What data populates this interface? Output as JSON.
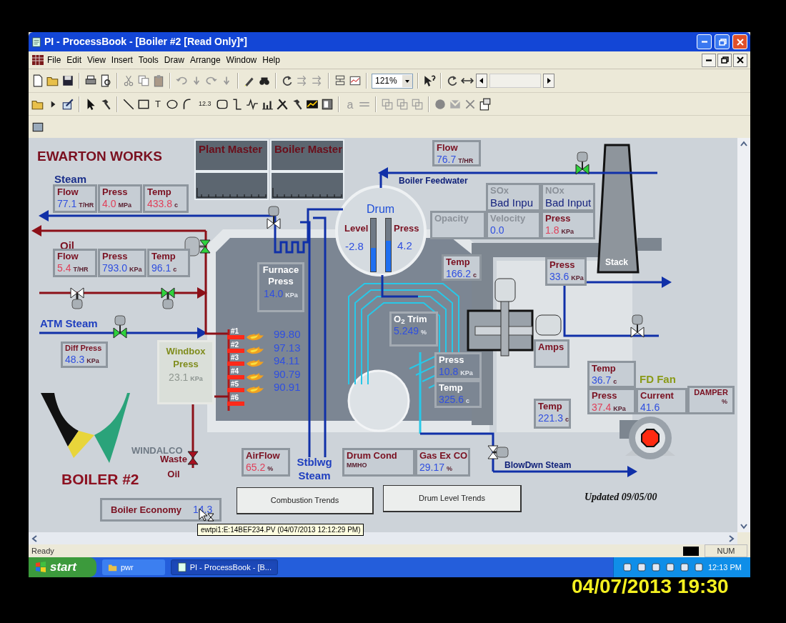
{
  "window": {
    "title": "PI - ProcessBook - [Boiler #2 [Read Only]*]"
  },
  "menu": [
    "File",
    "Edit",
    "View",
    "Insert",
    "Tools",
    "Draw",
    "Arrange",
    "Window",
    "Help"
  ],
  "toolbar": {
    "zoom": "121%",
    "text_tool": "T",
    "value_tool": "12.3",
    "font_tool": "a"
  },
  "display": {
    "labels": [
      {
        "text": "EWARTON WORKS"
      },
      {
        "text": "Steam"
      },
      {
        "text": "Oil"
      },
      {
        "text": "ATM Steam"
      },
      {
        "text": "Boiler Feedwater"
      },
      {
        "text": "Waste Oil"
      },
      {
        "text": "Stblwg Steam"
      },
      {
        "text": "BlowDwn Steam"
      },
      {
        "text": "FD Fan"
      },
      {
        "text": "Stack"
      },
      {
        "text": "WINDALCO"
      },
      {
        "text": "BOILER #2"
      },
      {
        "text": "Updated 09/05/00"
      }
    ],
    "masters": [
      "Plant Master",
      "Boiler Master"
    ],
    "readouts": [
      {
        "label": "Flow",
        "value": "77.1",
        "unit": "T/HR",
        "alarm": false,
        "kind": "light"
      },
      {
        "label": "Press",
        "value": "4.0",
        "unit": "MPa",
        "alarm": true,
        "kind": "light"
      },
      {
        "label": "Temp",
        "value": "433.8",
        "unit": "c",
        "alarm": true,
        "kind": "light"
      },
      {
        "label": "Flow",
        "value": "5.4",
        "unit": "T/HR",
        "alarm": true,
        "kind": "light"
      },
      {
        "label": "Press",
        "value": "793.0",
        "unit": "KPa",
        "alarm": false,
        "kind": "light"
      },
      {
        "label": "Temp",
        "value": "96.1",
        "unit": "c",
        "alarm": false,
        "kind": "light"
      },
      {
        "label": "Diff Press",
        "value": "48.3",
        "unit": "KPa",
        "alarm": false,
        "kind": "light"
      },
      {
        "label": "Windbox Press",
        "value": "23.1",
        "unit": "KPa",
        "kind": "olive"
      },
      {
        "label": "Furnace Press",
        "value": "14.0",
        "unit": "KPa",
        "alarm": false,
        "kind": "dark"
      },
      {
        "label": "Flow",
        "value": "76.7",
        "unit": "T/HR",
        "alarm": false,
        "kind": "light"
      },
      {
        "label": "SOx",
        "value": "Bad Inpu",
        "kind": "bad"
      },
      {
        "label": "NOx",
        "value": "Bad Input",
        "kind": "bad"
      },
      {
        "label": "Opacity",
        "kind": "dim"
      },
      {
        "label": "Velocity",
        "value": "0.0",
        "alarm": false,
        "kind": "dim"
      },
      {
        "label": "Press",
        "value": "1.8",
        "unit": "KPa",
        "alarm": true,
        "kind": "light"
      },
      {
        "label": "Temp",
        "value": "166.2",
        "unit": "c",
        "alarm": false,
        "kind": "light"
      },
      {
        "label": "Press",
        "value": "33.6",
        "unit": "KPa",
        "alarm": false,
        "kind": "light"
      },
      {
        "label": "O$_{2}$ Trim",
        "value": "5.249",
        "unit": "%",
        "alarm": false,
        "kind": "dark"
      },
      {
        "label": "Press",
        "value": "10.8",
        "unit": "KPa",
        "alarm": false,
        "kind": "dark"
      },
      {
        "label": "Temp",
        "value": "325.6",
        "unit": "c",
        "alarm": false,
        "kind": "dark"
      },
      {
        "label": "Amps",
        "kind": "light"
      },
      {
        "label": "Temp",
        "value": "221.3",
        "unit": "c",
        "alarm": false,
        "kind": "light"
      },
      {
        "label": "Temp",
        "value": "36.7",
        "unit": "c",
        "alarm": false,
        "kind": "light"
      },
      {
        "label": "Press",
        "value": "37.4",
        "unit": "KPa",
        "alarm": true,
        "kind": "light"
      },
      {
        "label": "Current",
        "value": "41.6",
        "alarm": false,
        "kind": "light"
      },
      {
        "label": "DAMPER",
        "unit": "%",
        "kind": "light"
      },
      {
        "label": "AirFlow",
        "value": "65.2",
        "unit": "%",
        "alarm": true,
        "kind": "light"
      },
      {
        "label": "Drum Cond",
        "unit": "MMHO",
        "kind": "light"
      },
      {
        "label": "Gas Ex CO",
        "value": "29.17",
        "unit": "%",
        "alarm": false,
        "kind": "light"
      },
      {
        "label": "Boiler Economy",
        "value": "14.3",
        "alarm": false,
        "kind": "inline"
      }
    ],
    "drum": {
      "title": "Drum",
      "gauges": [
        {
          "label": "Level",
          "value": "-2.8",
          "level": 0.45
        },
        {
          "label": "Press",
          "value": "4.2",
          "level": 0.58
        }
      ]
    },
    "burners": [
      {
        "label": "#1",
        "value": "99.80",
        "firing": true
      },
      {
        "label": "#2",
        "value": "97.13",
        "firing": true
      },
      {
        "label": "#3",
        "value": "94.11",
        "firing": true
      },
      {
        "label": "#4",
        "value": "90.79",
        "firing": true
      },
      {
        "label": "#5",
        "value": "90.91",
        "firing": true
      },
      {
        "label": "#6",
        "firing": false
      }
    ],
    "buttons": [
      "Combustion Trends",
      "Drum Level Trends"
    ]
  },
  "tooltip": "ewtpi1:E:14BEF234.PV (04/07/2013 12:12:29 PM)",
  "status_bar": {
    "text": "Ready",
    "indicator": "NUM"
  },
  "taskbar": {
    "start": "start",
    "items": [
      {
        "label": "pwr",
        "selected": false
      },
      {
        "label": "PI - ProcessBook - [B...",
        "selected": true
      }
    ],
    "clock": "12:13 PM"
  },
  "camera_timestamp": "04/07/2013 19:30"
}
